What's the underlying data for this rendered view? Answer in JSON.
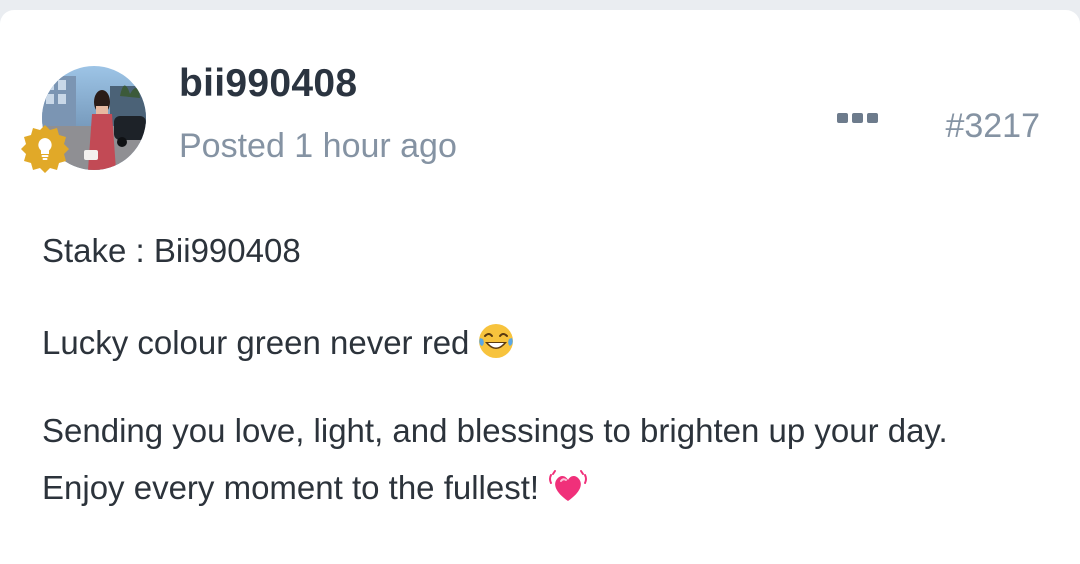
{
  "post": {
    "username": "bii990408",
    "posted_time": "Posted 1 hour ago",
    "post_number": "#3217",
    "body": {
      "line1": "Stake : Bii990408",
      "line2": "Lucky colour green never red",
      "line3a": " Sending you love, light, and blessings to brighten up your day.",
      "line3b": "Enjoy every moment to the fullest!"
    }
  },
  "icons": {
    "badge": "lightbulb-badge-icon",
    "more": "more-options-icon",
    "emoji1": "laughing-tears-emoji-icon",
    "emoji2": "beating-heart-emoji-icon"
  },
  "colors": {
    "background": "#eaedf1",
    "card": "#ffffff",
    "username": "#2b3440",
    "meta": "#8593a3",
    "body_text": "#2c333b",
    "badge": "#e1a928",
    "more_icon": "#6d7b8c"
  }
}
